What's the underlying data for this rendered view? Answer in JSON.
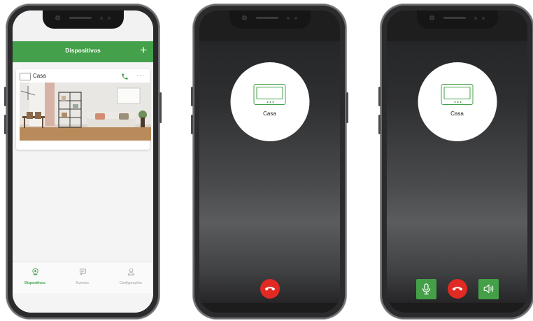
{
  "colors": {
    "brand_green": "#44a04a",
    "hangup_red": "#e02a23",
    "phone_frame": "#2b2b2d"
  },
  "devices_screen": {
    "header": {
      "title": "Dispositivos",
      "add_icon": "plus-icon"
    },
    "device_card": {
      "name": "Casa",
      "call_icon": "phone-icon",
      "more_icon": "more-dots-icon",
      "more_text": "···"
    },
    "bottom_nav": [
      {
        "label": "Dispositivos",
        "icon": "devices-icon",
        "active": true
      },
      {
        "label": "Eventos",
        "icon": "events-icon",
        "active": false
      },
      {
        "label": "Configurações",
        "icon": "settings-user-icon",
        "active": false
      }
    ]
  },
  "incoming_call": {
    "device_name": "Casa",
    "hangup_icon": "hangup-icon"
  },
  "active_call": {
    "device_name": "Casa",
    "mic_icon": "microphone-icon",
    "hangup_icon": "hangup-icon",
    "speaker_icon": "speaker-icon"
  }
}
